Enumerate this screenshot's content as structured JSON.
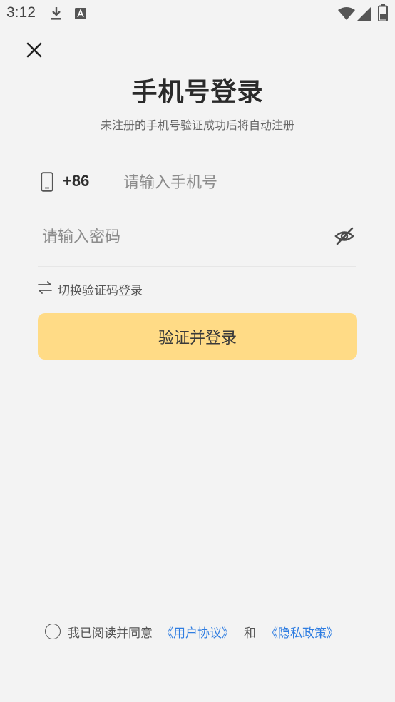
{
  "status_bar": {
    "time": "3:12",
    "icons": [
      "download-icon",
      "a-badge-icon",
      "wifi-icon",
      "signal-icon",
      "battery-icon"
    ]
  },
  "close_icon": "close-icon",
  "title": "手机号登录",
  "subtitle": "未注册的手机号验证成功后将自动注册",
  "phone": {
    "icon": "phone-icon",
    "country_code": "+86",
    "placeholder": "请输入手机号",
    "value": ""
  },
  "password": {
    "placeholder": "请输入密码",
    "value": "",
    "toggle_icon": "eye-off-icon"
  },
  "switch_login": {
    "icon": "swap-icon",
    "label": "切换验证码登录"
  },
  "submit_label": "验证并登录",
  "agreement": {
    "prefix": "我已阅读并同意",
    "user_agreement": "《用户协议》",
    "and": "和",
    "privacy_policy": "《隐私政策》",
    "checked": false
  },
  "colors": {
    "background": "#f3f3f3",
    "button": "#ffdb86",
    "link": "#2f7de1"
  }
}
